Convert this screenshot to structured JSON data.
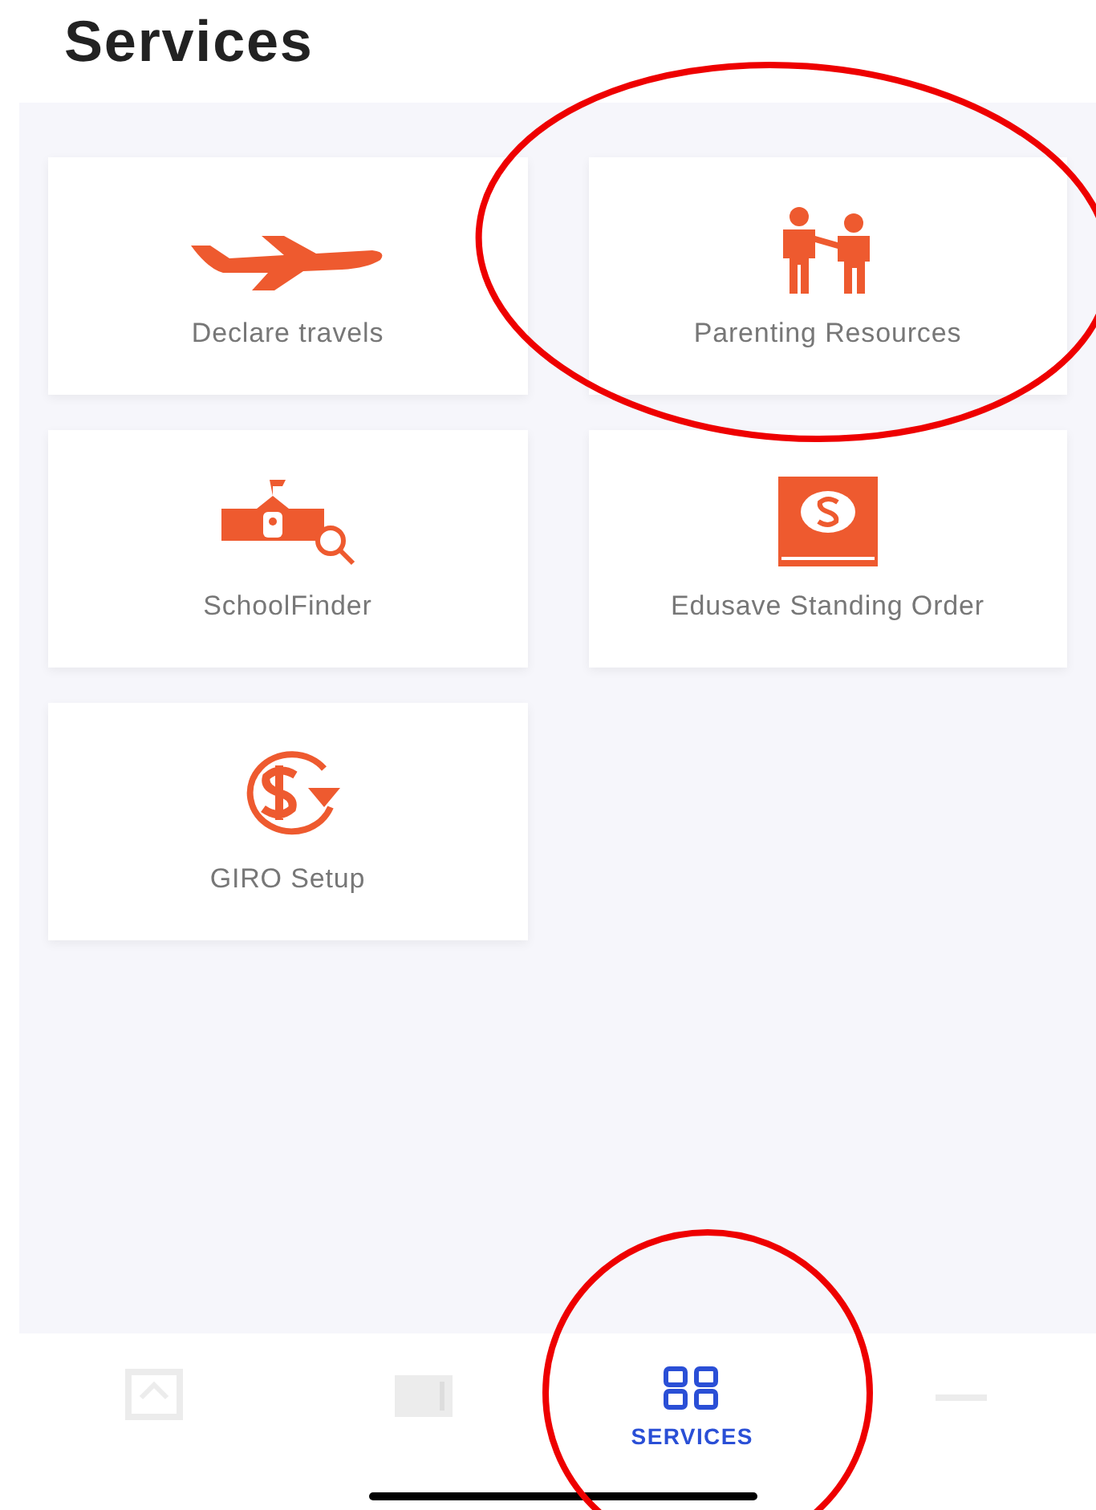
{
  "title": "Services",
  "services": [
    {
      "label": "Declare travels",
      "kind": "plane"
    },
    {
      "label": "Parenting Resources",
      "kind": "parents"
    },
    {
      "label": "SchoolFinder",
      "kind": "school"
    },
    {
      "label": "Edusave Standing Order",
      "kind": "book"
    },
    {
      "label": "GIRO Setup",
      "kind": "giro"
    }
  ],
  "tabs": [
    {
      "selected": false,
      "kind": "home"
    },
    {
      "selected": false,
      "kind": "school"
    },
    {
      "selected": true,
      "kind": "grid",
      "label": "SERVICES"
    },
    {
      "selected": false,
      "kind": "more"
    }
  ]
}
